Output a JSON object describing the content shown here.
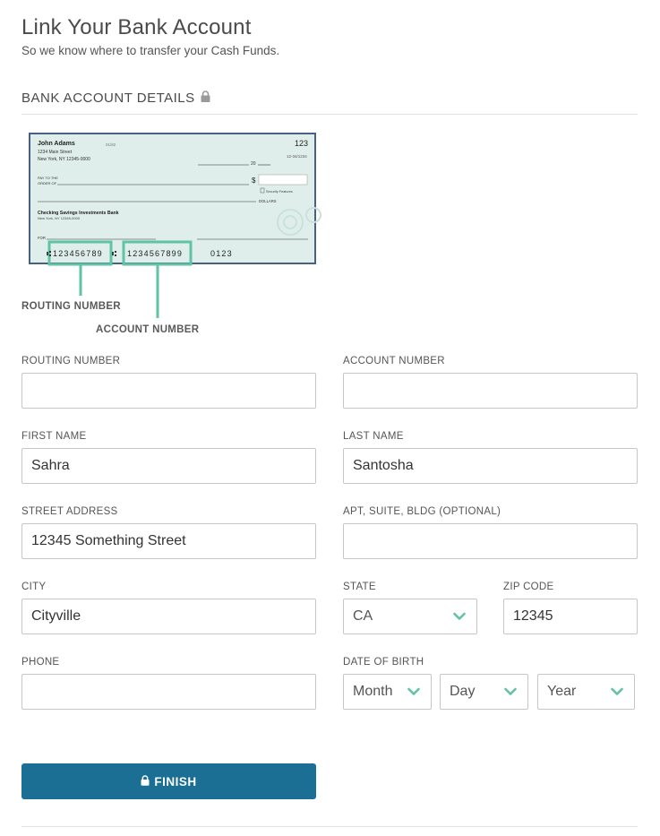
{
  "header": {
    "title": "Link Your Bank Account",
    "subtitle": "So we know where to transfer your Cash Funds."
  },
  "section": {
    "title": "BANK ACCOUNT DETAILS",
    "icon": "lock-icon"
  },
  "check": {
    "name": "John Adams",
    "address_line1": "1234 Main Street",
    "address_line2": "New York, NY 12345-0000",
    "date_code": "01/82",
    "check_number": "123",
    "fraction": "12-34/1234",
    "date_prefix": "20",
    "pay_to_line1": "PAY TO THE",
    "pay_to_line2": "ORDER OF",
    "dollar_sign": "$",
    "security_features": "Security Features",
    "dollars": "DOLLARS",
    "bank_name": "Checking Savings Investments Bank",
    "bank_address": "New York, NY 12345-0000",
    "memo": "FOR",
    "routing_digits": "123456789",
    "account_digits": "1234567899",
    "check_digits": "0123",
    "routing_label": "ROUTING NUMBER",
    "account_label": "ACCOUNT NUMBER",
    "accent_color": "#5fc3a4"
  },
  "form": {
    "routing_number": {
      "label": "ROUTING NUMBER",
      "value": "",
      "placeholder": ""
    },
    "account_number": {
      "label": "ACCOUNT NUMBER",
      "value": "",
      "placeholder": ""
    },
    "first_name": {
      "label": "FIRST NAME",
      "value": "Sahra"
    },
    "last_name": {
      "label": "LAST NAME",
      "value": "Santosha"
    },
    "street_address": {
      "label": "STREET ADDRESS",
      "value": "12345 Something Street"
    },
    "apt": {
      "label": "APT, SUITE, BLDG (OPTIONAL)",
      "value": ""
    },
    "city": {
      "label": "CITY",
      "value": "Cityville"
    },
    "state": {
      "label": "STATE",
      "value": "CA"
    },
    "zip": {
      "label": "ZIP CODE",
      "value": "12345"
    },
    "phone": {
      "label": "PHONE",
      "value": ""
    },
    "dob": {
      "label": "DATE OF BIRTH",
      "month": "Month",
      "day": "Day",
      "year": "Year"
    }
  },
  "actions": {
    "finish_label": "FINISH"
  },
  "colors": {
    "primary": "#1b6f95",
    "chevron": "#5fc3a4",
    "check_border": "#4a6080"
  }
}
